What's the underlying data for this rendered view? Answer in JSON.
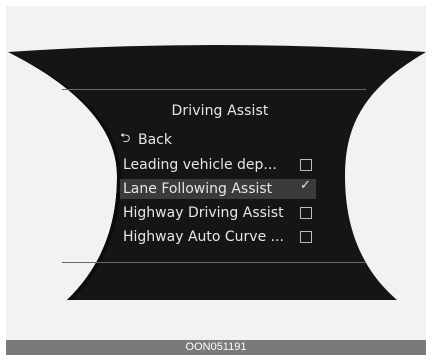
{
  "menu": {
    "title": "Driving Assist",
    "back_label": "Back",
    "items": [
      {
        "label": "Leading vehicle dep...",
        "checked": false
      },
      {
        "label": "Lane Following Assist",
        "checked": true
      },
      {
        "label": "Highway Driving Assist",
        "checked": false
      },
      {
        "label": "Highway Auto Curve ...",
        "checked": false
      }
    ],
    "selected_index": 1
  },
  "footer": {
    "code": "OON051191"
  },
  "colors": {
    "display_bg": "#151515",
    "text": "#e6e6e6",
    "selection_bg": "#3b3b3b",
    "footer_bg": "#7a7a7a"
  },
  "icons": {
    "back": "back-arrow-icon",
    "checked": "check-icon",
    "unchecked": "checkbox-empty-icon"
  }
}
